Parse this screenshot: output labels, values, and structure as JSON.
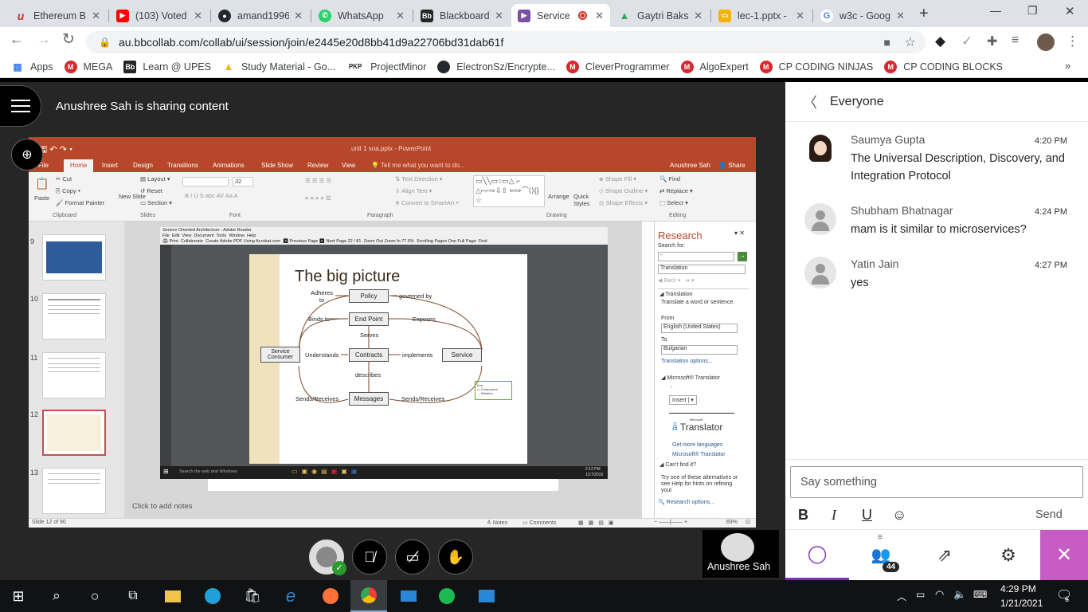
{
  "browser": {
    "tabs": [
      {
        "title": "Ethereum B",
        "fav_color": "#c0392b",
        "fav_glyph": "u"
      },
      {
        "title": "(103) Voted",
        "fav_color": "#ff0000",
        "fav_glyph": "▶"
      },
      {
        "title": "amand1996",
        "fav_color": "#24292e",
        "fav_glyph": "●"
      },
      {
        "title": "WhatsApp",
        "fav_color": "#25d366",
        "fav_glyph": "✆"
      },
      {
        "title": "Blackboard",
        "fav_color": "#262626",
        "fav_glyph": "Bb"
      },
      {
        "title": "Service",
        "fav_color": "#7b4ea8",
        "fav_glyph": "▶"
      },
      {
        "title": "Gaytri Baksl",
        "fav_color": "#34a853",
        "fav_glyph": "▲"
      },
      {
        "title": "lec-1.pptx -",
        "fav_color": "#f4b400",
        "fav_glyph": "▭"
      },
      {
        "title": "w3c - Goog",
        "fav_color": "#4285f4",
        "fav_glyph": "G"
      }
    ],
    "url": "au.bbcollab.com/collab/ui/session/join/e2445e20d8bb41d9a22706bd31dab61f",
    "bookmarks": [
      {
        "label": "Apps",
        "color": "#4285f4",
        "glyph": "⋮⋮"
      },
      {
        "label": "MEGA",
        "color": "#d9272e",
        "glyph": "M"
      },
      {
        "label": "Learn @ UPES",
        "color": "#262626",
        "glyph": "Bb"
      },
      {
        "label": "Study Material - Go...",
        "color": "#f4b400",
        "glyph": "▲"
      },
      {
        "label": "ProjectMinor",
        "color": "#ffffff",
        "glyph": "PKP"
      },
      {
        "label": "ElectronSz/Encrypte...",
        "color": "#24292e",
        "glyph": "●"
      },
      {
        "label": "CleverProgrammer",
        "color": "#d9272e",
        "glyph": "M"
      },
      {
        "label": "AlgoExpert",
        "color": "#d9272e",
        "glyph": "M"
      },
      {
        "label": "CP CODING NINJAS",
        "color": "#d9272e",
        "glyph": "M"
      },
      {
        "label": "CP CODING BLOCKS",
        "color": "#d9272e",
        "glyph": "M"
      }
    ]
  },
  "session": {
    "sharing_text": "Anushree Sah is sharing content",
    "presenter_name": "Anushree Sah"
  },
  "ppt": {
    "title": "unit 1 soa.pptx - PowerPoint",
    "user": "Anushree Sah",
    "share": "Share",
    "tabs": [
      "File",
      "Home",
      "Insert",
      "Design",
      "Transitions",
      "Animations",
      "Slide Show",
      "Review",
      "View"
    ],
    "tell_me": "Tell me what you want to do...",
    "clipboard": {
      "paste": "Paste",
      "cut": "Cut",
      "copy": "Copy",
      "format_painter": "Format Painter",
      "group": "Clipboard"
    },
    "slides": {
      "new_slide": "New Slide",
      "layout": "Layout",
      "reset": "Reset",
      "section": "Section",
      "group": "Slides"
    },
    "font": {
      "size": "32",
      "group": "Font"
    },
    "paragraph": {
      "text_direction": "Text Direction",
      "align_text": "Align Text",
      "smartart": "Convert to SmartArt",
      "group": "Paragraph"
    },
    "drawing": {
      "arrange": "Arrange",
      "quick_styles": "Quick Styles",
      "shape_fill": "Shape Fill",
      "shape_outline": "Shape Outline",
      "shape_effects": "Shape Effects",
      "group": "Drawing"
    },
    "editing": {
      "find": "Find",
      "replace": "Replace",
      "select": "Select",
      "group": "Editing"
    },
    "thumb_numbers": [
      "9",
      "10",
      "11",
      "12",
      "13"
    ],
    "notes_placeholder": "Click to add notes",
    "status_slide": "Slide 12 of 90",
    "notes": "Notes",
    "comments": "Comments",
    "zoom": "69%"
  },
  "reader": {
    "title": "Service Oriented Architecture - Adobe Reader",
    "menu": [
      "File",
      "Edit",
      "View",
      "Document",
      "Tools",
      "Window",
      "Help"
    ],
    "tools": [
      "Print",
      "Collaborate",
      "Create Adobe PDF Using Acrobat.com",
      "Previous Page",
      "Next Page",
      "Zoom Out",
      "Zoom In",
      "Scrolling Pages",
      "One Full Page"
    ],
    "page": "22",
    "pages": "81",
    "zoom": "77.5%",
    "find": "Find",
    "search": "Search the web and Windows",
    "clock": "2:12 PM",
    "date": "1/17/2016"
  },
  "diagram": {
    "title": "The big picture",
    "boxes": {
      "policy": "Policy",
      "endpoint": "End Point",
      "contracts": "Contracts",
      "messages": "Messages",
      "consumer": "Service Consumer",
      "service": "Service"
    },
    "labels": {
      "adheres": "Adheres to",
      "governed": "governed by",
      "binds": "Binds to",
      "exposes": "Exposes",
      "serves": "Serves",
      "understands": "Understands",
      "implements": "implements",
      "describes": "describes",
      "sends1": "Sends/Receives",
      "sends2": "Sends/Receives"
    },
    "key": {
      "title": "Key",
      "component": "Component",
      "relation": "Relation"
    }
  },
  "research": {
    "title": "Research",
    "search_for": "Search for:",
    "query": "-",
    "source": "Translation",
    "back": "Back",
    "translation": "Translation",
    "translate_desc": "Translate a word or sentence.",
    "from": "From",
    "from_lang": "English (United States)",
    "to": "To",
    "to_lang": "Bulgarian",
    "options": "Translation options...",
    "ms_translator": "Microsoft® Translator",
    "dash": "-",
    "insert": "Insert",
    "brand_small": "Microsoft",
    "brand": "Translator",
    "more_langs": "Get more languages",
    "ms_link": "Microsoft® Translator",
    "cant_find": "Can't find it?",
    "hint": "Try one of these alternatives or see Help for hints on refining your",
    "research_options": "Research options..."
  },
  "chat": {
    "header": "Everyone",
    "messages": [
      {
        "name": "Saumya Gupta",
        "time": "4:20 PM",
        "text": "The Universal Description, Discovery, and Integration Protocol"
      },
      {
        "name": "Shubham Bhatnagar",
        "time": "4:24 PM",
        "text": "mam is it similar to microservices?"
      },
      {
        "name": "Yatin Jain",
        "time": "4:27 PM",
        "text": "yes"
      }
    ],
    "placeholder": "Say something",
    "send": "Send",
    "bold": "B",
    "italic": "I",
    "underline": "U",
    "attendees": "44"
  },
  "taskbar": {
    "time": "4:29 PM",
    "date": "1/21/2021",
    "notifications": "6"
  }
}
